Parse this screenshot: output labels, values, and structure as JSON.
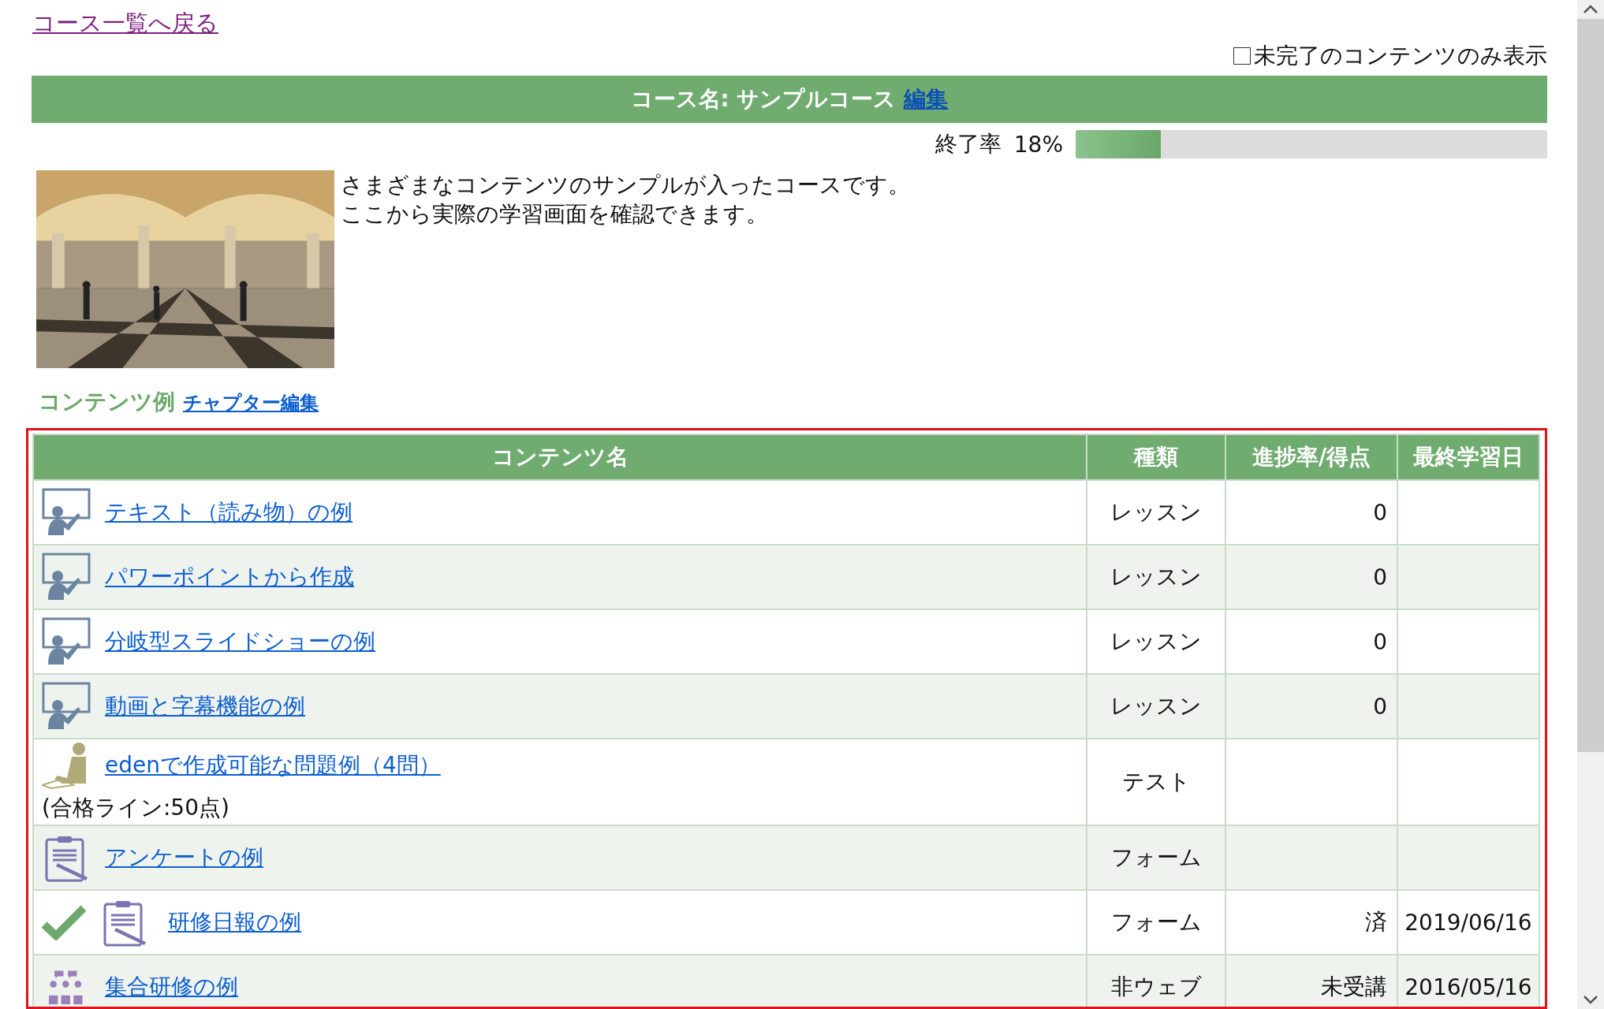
{
  "back_link": "コース一覧へ戻る",
  "filter": {
    "label": "未完了のコンテンツのみ表示",
    "checked": false
  },
  "course": {
    "title": "コース名: サンプルコース",
    "edit_link": "編集"
  },
  "completion": {
    "label": "終了率",
    "reading": "18%",
    "level": 0.18
  },
  "description": [
    "さまざまなコンテンツのサンプルが入ったコースです。",
    "ここから実際の学習画面を確認できます。"
  ],
  "chapter": {
    "title": "コンテンツ例",
    "edit_link": "チャプター編集"
  },
  "table": {
    "columns": [
      "コンテンツ名",
      "種類",
      "進捗率/得点",
      "最終学習日"
    ],
    "rows": [
      {
        "kind": "lesson",
        "done": false,
        "title": "テキスト（読み物）の例",
        "type": "レッスン",
        "progress": "0"
      },
      {
        "kind": "lesson",
        "done": false,
        "title": "パワーポイントから作成",
        "type": "レッスン",
        "progress": "0"
      },
      {
        "kind": "lesson",
        "done": false,
        "title": "分岐型スライドショーの例",
        "type": "レッスン",
        "progress": "0"
      },
      {
        "kind": "lesson",
        "done": false,
        "title": "動画と字幕機能の例",
        "type": "レッスン",
        "progress": "0"
      },
      {
        "kind": "test",
        "done": false,
        "title": "edenで作成可能な問題例（4問）",
        "note": "(合格ライン:50点)",
        "type": "テスト"
      },
      {
        "kind": "form",
        "done": false,
        "title": "アンケートの例",
        "type": "フォーム"
      },
      {
        "kind": "form",
        "done": true,
        "title": "研修日報の例",
        "type": "フォーム",
        "progress": "済",
        "date": "2019/06/16"
      },
      {
        "kind": "meeting",
        "done": false,
        "title": "集合研修の例",
        "type": "非ウェブ",
        "progress": "未受講",
        "date": "2016/05/16"
      }
    ]
  }
}
